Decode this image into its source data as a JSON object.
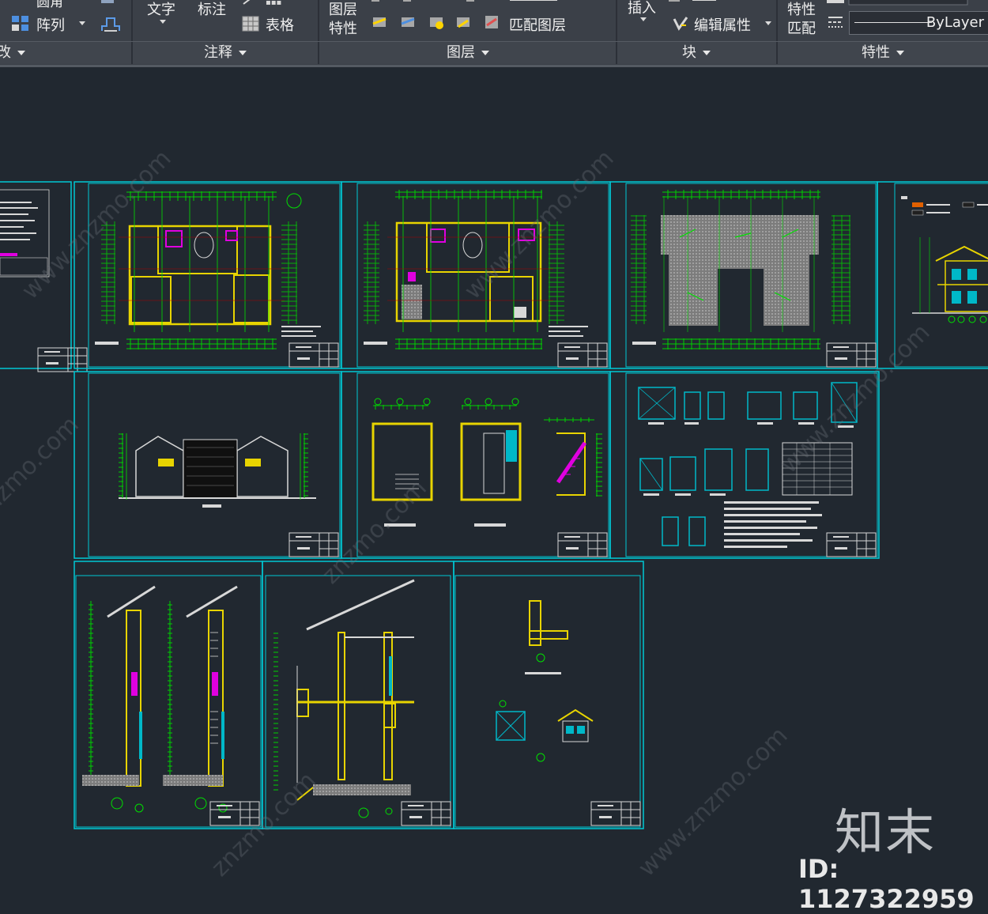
{
  "ribbon": {
    "modify_partial_top": "圆角",
    "array_label": "阵列",
    "text_label": "文字",
    "dimension_label": "标注",
    "table_label": "表格",
    "layer_properties_line1": "图层",
    "layer_properties_line2": "特性",
    "match_layer_label": "匹配图层",
    "insert_label": "插入",
    "edit_attributes_label": "编辑属性",
    "match_properties_line1": "特性",
    "match_properties_line2": "匹配",
    "bylayer_value": "ByLayer",
    "panels": {
      "modify_partial": "改",
      "annotation": "注释",
      "layers": "图层",
      "block": "块",
      "properties": "特性"
    }
  },
  "watermark": {
    "brand": "知末",
    "id_text": "ID: 1127322959",
    "diagonal": "znzmo.com"
  },
  "colors": {
    "canvas_bg": "#212830",
    "sheet_border": "#00c8d4",
    "drawing_green": "#00e000",
    "drawing_yellow": "#e8d400",
    "drawing_magenta": "#e000e0",
    "wall_fill": "#8a8a8a"
  }
}
